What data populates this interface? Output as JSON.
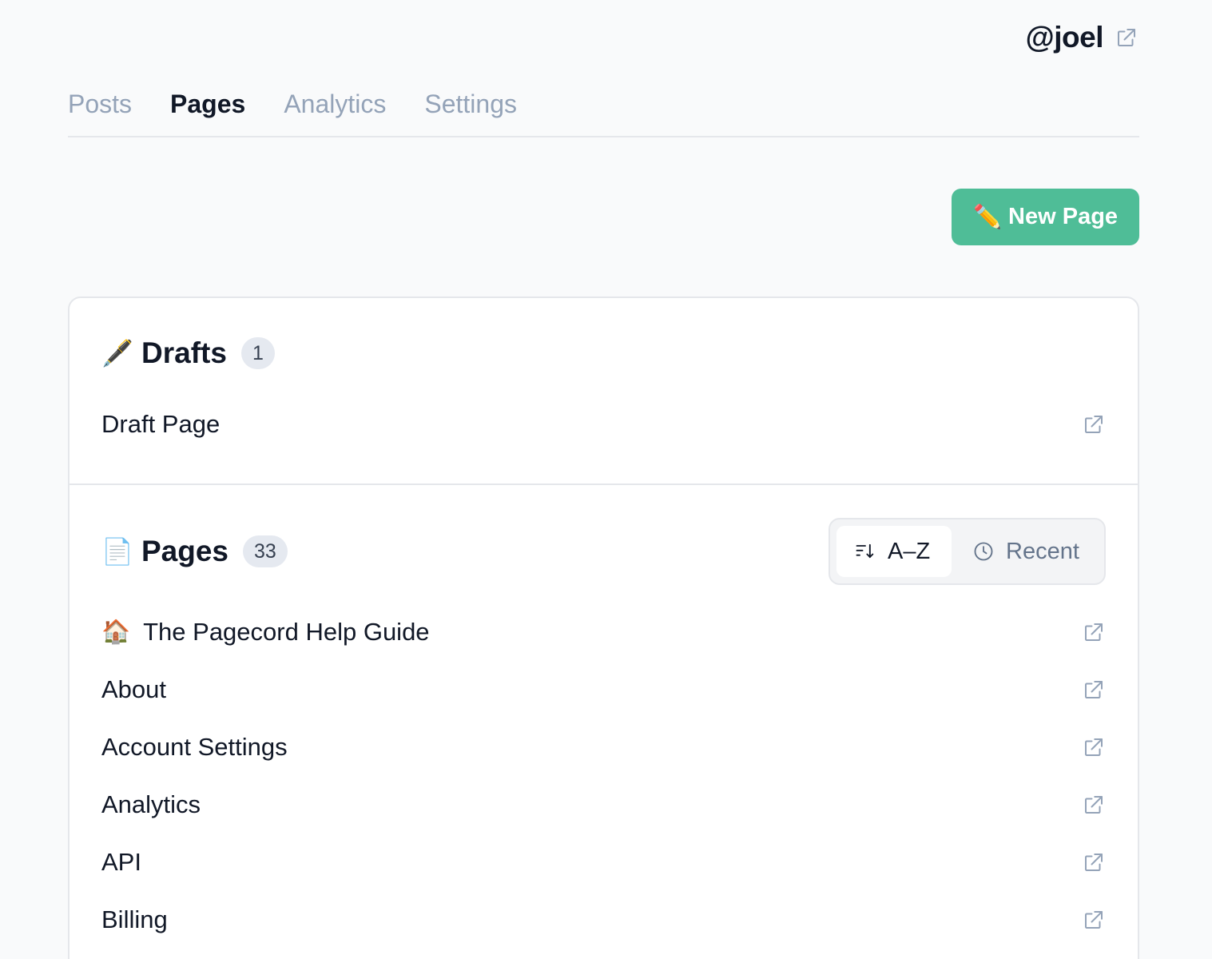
{
  "header": {
    "username": "@joel"
  },
  "tabs": [
    {
      "label": "Posts",
      "active": false
    },
    {
      "label": "Pages",
      "active": true
    },
    {
      "label": "Analytics",
      "active": false
    },
    {
      "label": "Settings",
      "active": false
    }
  ],
  "new_page_button": {
    "icon": "✏️",
    "label": "New Page",
    "color": "#4fbd97"
  },
  "drafts": {
    "icon": "🖋️",
    "title": "Drafts",
    "count": "1",
    "items": [
      {
        "title": "Draft Page"
      }
    ]
  },
  "pages": {
    "icon": "📄",
    "title": "Pages",
    "count": "33",
    "sort": {
      "options": [
        {
          "label": "A–Z",
          "icon": "sort-alpha-icon",
          "active": true
        },
        {
          "label": "Recent",
          "icon": "clock-icon",
          "active": false
        }
      ]
    },
    "items": [
      {
        "emoji": "🏠",
        "title": "The Pagecord Help Guide"
      },
      {
        "emoji": "",
        "title": "About"
      },
      {
        "emoji": "",
        "title": "Account Settings"
      },
      {
        "emoji": "",
        "title": "Analytics"
      },
      {
        "emoji": "",
        "title": "API"
      },
      {
        "emoji": "",
        "title": "Billing"
      }
    ]
  }
}
